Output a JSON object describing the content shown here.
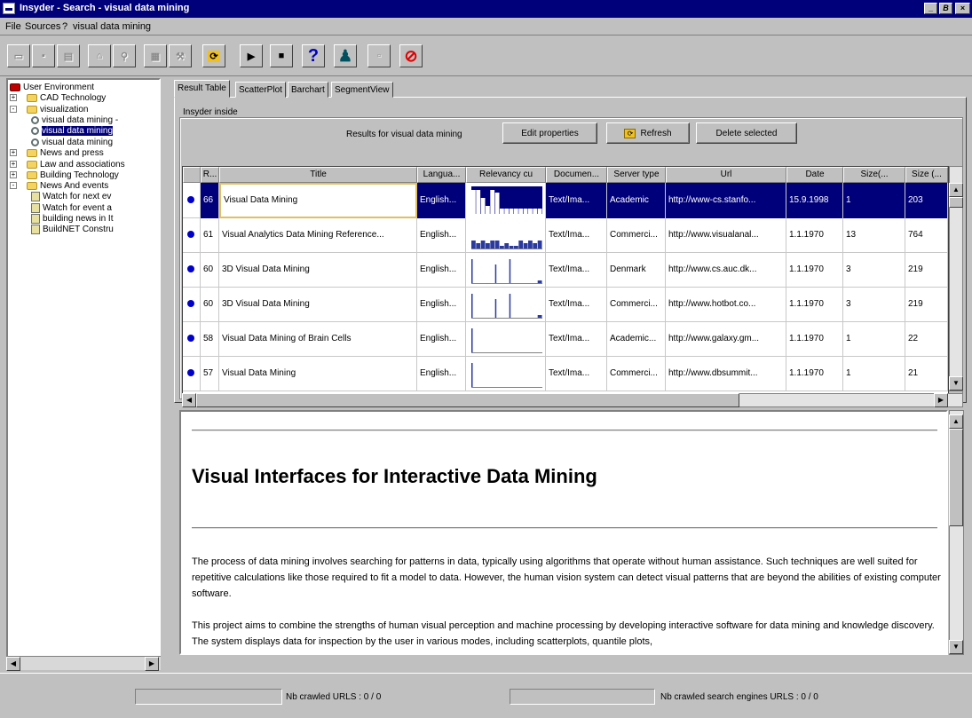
{
  "window": {
    "title": "Insyder - Search - visual data mining",
    "controls": [
      "_",
      "̅",
      "×"
    ]
  },
  "menubar": [
    "File",
    "Sources",
    "?",
    "visual data mining"
  ],
  "toolbar": {
    "buttons": [
      {
        "name": "open-icon",
        "glyph": "▭",
        "enabled": false
      },
      {
        "name": "save-icon",
        "glyph": "▪",
        "enabled": false
      },
      {
        "name": "list-icon",
        "glyph": "▤",
        "enabled": false
      },
      {
        "name": "home-icon",
        "glyph": "⌂",
        "enabled": false
      },
      {
        "name": "find-icon",
        "glyph": "⚲",
        "enabled": false
      },
      {
        "name": "view-icon",
        "glyph": "▦",
        "enabled": false
      },
      {
        "name": "tools-icon",
        "glyph": "⚒",
        "enabled": false
      },
      {
        "name": "refresh-icon",
        "glyph": "⟳",
        "enabled": true
      },
      {
        "name": "play-icon",
        "glyph": "▶",
        "enabled": true
      },
      {
        "name": "stop-icon",
        "glyph": "■",
        "enabled": true
      },
      {
        "name": "help-icon",
        "glyph": "?",
        "enabled": true
      },
      {
        "name": "agent-icon",
        "glyph": "♟",
        "enabled": true
      },
      {
        "name": "blank-icon",
        "glyph": "▫",
        "enabled": false
      },
      {
        "name": "cancel-icon",
        "glyph": "⊘",
        "enabled": true
      }
    ]
  },
  "tree": {
    "items": [
      {
        "label": "User Environment",
        "kind": "root",
        "level": 0,
        "pm": ""
      },
      {
        "label": "CAD Technology",
        "kind": "folder",
        "level": 1,
        "pm": "+"
      },
      {
        "label": "visualization",
        "kind": "folder",
        "level": 1,
        "pm": "-"
      },
      {
        "label": "visual data mining -",
        "kind": "query",
        "level": 2,
        "pm": ""
      },
      {
        "label": "visual data mining",
        "kind": "query",
        "level": 2,
        "pm": "",
        "selected": true
      },
      {
        "label": "visual data mining",
        "kind": "query",
        "level": 2,
        "pm": ""
      },
      {
        "label": "News and press",
        "kind": "folder",
        "level": 1,
        "pm": "+"
      },
      {
        "label": "Law and associations",
        "kind": "folder",
        "level": 1,
        "pm": "+"
      },
      {
        "label": "Building Technology",
        "kind": "folder",
        "level": 1,
        "pm": "+"
      },
      {
        "label": "News And events",
        "kind": "folder",
        "level": 1,
        "pm": "-"
      },
      {
        "label": "Watch for next ev",
        "kind": "watch",
        "level": 2,
        "pm": ""
      },
      {
        "label": "Watch for event a",
        "kind": "watch",
        "level": 2,
        "pm": ""
      },
      {
        "label": "building news in It",
        "kind": "doc",
        "level": 2,
        "pm": ""
      },
      {
        "label": "BuildNET Constru",
        "kind": "doc",
        "level": 2,
        "pm": ""
      }
    ]
  },
  "tabs": [
    "Result Table",
    "ScatterPlot",
    "Barchart",
    "SegmentView"
  ],
  "inside_label": "Insyder inside",
  "results_label": "Results for visual data mining",
  "buttons": {
    "edit": "Edit properties",
    "refresh": "Refresh",
    "delete": "Delete selected"
  },
  "table": {
    "columns": [
      "R...",
      "Title",
      "Langua...",
      "Relevancy cu",
      "Documen...",
      "Server type",
      "Url",
      "Date",
      "Size(...",
      "Size (..."
    ],
    "rows": [
      {
        "r": "66",
        "title": "Visual Data Mining",
        "lang": "English...",
        "doc": "Text/Ima...",
        "server": "Academic",
        "url": "http://www-cs.stanfo...",
        "date": "15.9.1998",
        "size1": "1",
        "size2": "203",
        "spark": [
          0.9,
          0.9,
          0.6,
          0.3,
          0.9,
          0.8,
          0.2,
          0.2,
          0.2,
          0.2,
          0.2,
          0.2,
          0.2,
          0.2,
          0.2
        ],
        "selected": true
      },
      {
        "r": "61",
        "title": "Visual Analytics Data Mining Reference...",
        "lang": "English...",
        "doc": "Text/Ima...",
        "server": "Commerci...",
        "url": "http://www.visualanal...",
        "date": "1.1.1970",
        "size1": "13",
        "size2": "764",
        "spark": [
          0.3,
          0.2,
          0.3,
          0.2,
          0.3,
          0.3,
          0.1,
          0.2,
          0.1,
          0.1,
          0.3,
          0.2,
          0.3,
          0.2,
          0.3
        ]
      },
      {
        "r": "60",
        "title": "3D Visual Data Mining",
        "lang": "English...",
        "doc": "Text/Ima...",
        "server": "Denmark",
        "url": "http://www.cs.auc.dk...",
        "date": "1.1.1970",
        "size1": "3",
        "size2": "219",
        "spark": [
          0.9,
          0,
          0,
          0,
          0,
          0.7,
          0,
          0,
          0.9,
          0,
          0,
          0,
          0,
          0,
          0.1
        ]
      },
      {
        "r": "60",
        "title": "3D Visual Data Mining",
        "lang": "English...",
        "doc": "Text/Ima...",
        "server": "Commerci...",
        "url": "http://www.hotbot.co...",
        "date": "1.1.1970",
        "size1": "3",
        "size2": "219",
        "spark": [
          0.9,
          0,
          0,
          0,
          0,
          0.7,
          0,
          0,
          0.9,
          0,
          0,
          0,
          0,
          0,
          0.1
        ]
      },
      {
        "r": "58",
        "title": "Visual Data Mining of Brain Cells",
        "lang": "English...",
        "doc": "Text/Ima...",
        "server": "Academic...",
        "url": "http://www.galaxy.gm...",
        "date": "1.1.1970",
        "size1": "1",
        "size2": "22",
        "spark": [
          0.9,
          0,
          0,
          0,
          0,
          0,
          0,
          0,
          0,
          0,
          0,
          0,
          0,
          0,
          0
        ]
      },
      {
        "r": "57",
        "title": "Visual Data Mining",
        "lang": "English...",
        "doc": "Text/Ima...",
        "server": "Commerci...",
        "url": "http://www.dbsummit...",
        "date": "1.1.1970",
        "size1": "1",
        "size2": "21",
        "spark": [
          0.9,
          0,
          0,
          0,
          0,
          0,
          0,
          0,
          0,
          0,
          0,
          0,
          0,
          0,
          0
        ]
      }
    ]
  },
  "document": {
    "heading": "Visual Interfaces for Interactive Data Mining",
    "p1": "The process of data mining involves searching for patterns in data, typically using algorithms that operate without human assistance. Such techniques are well suited for repetitive calculations like those required to fit a model to data. However, the human vision system can detect visual patterns that are beyond the abilities of existing computer software.",
    "p2": "This project aims to combine the strengths of human visual perception and machine processing by developing interactive software for data mining and knowledge discovery. The system displays data for inspection by the user in various modes, including scatterplots, quantile plots,"
  },
  "status": {
    "crawled_urls": "Nb crawled URLS : 0 / 0",
    "crawled_engines": "Nb crawled search engines URLS : 0 / 0"
  },
  "colors": {
    "title_bar": "#00007b",
    "selection": "#00007b",
    "dot": "#0000c8",
    "spark": "#2a3aa0"
  }
}
